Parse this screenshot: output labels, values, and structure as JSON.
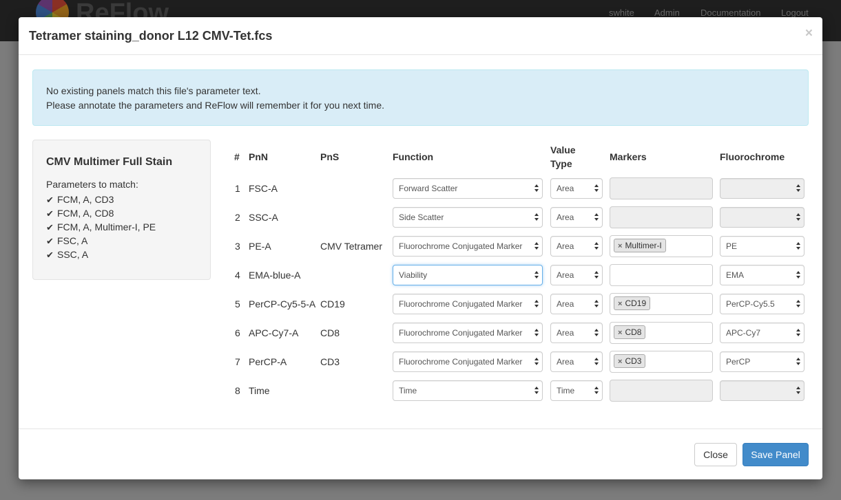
{
  "navbar": {
    "brand": "ReFlow",
    "links": [
      "swhite",
      "Admin",
      "Documentation",
      "Logout"
    ]
  },
  "modal": {
    "title": "Tetramer staining_donor L12 CMV-Tet.fcs",
    "close_symbol": "×"
  },
  "alert": {
    "line1": "No existing panels match this file's parameter text.",
    "line2": "Please annotate the parameters and ReFlow will remember it for you next time."
  },
  "panel": {
    "name": "CMV Multimer Full Stain",
    "params_label": "Parameters to match:",
    "params": [
      "FCM, A, CD3",
      "FCM, A, CD8",
      "FCM, A, Multimer-I, PE",
      "FSC, A",
      "SSC, A"
    ]
  },
  "table": {
    "headers": {
      "num": "#",
      "pnn": "PnN",
      "pns": "PnS",
      "function": "Function",
      "value_type_1": "Value",
      "value_type_2": "Type",
      "markers": "Markers",
      "fluorochrome": "Fluorochrome"
    },
    "rows": [
      {
        "num": "1",
        "pnn": "FSC-A",
        "pns": "",
        "function": "Forward Scatter",
        "value_type": "Area",
        "marker": "",
        "fluorochrome": ""
      },
      {
        "num": "2",
        "pnn": "SSC-A",
        "pns": "",
        "function": "Side Scatter",
        "value_type": "Area",
        "marker": "",
        "fluorochrome": ""
      },
      {
        "num": "3",
        "pnn": "PE-A",
        "pns": "CMV Tetramer",
        "function": "Fluorochrome Conjugated Marker",
        "value_type": "Area",
        "marker": "Multimer-I",
        "fluorochrome": "PE"
      },
      {
        "num": "4",
        "pnn": "EMA-blue-A",
        "pns": "",
        "function": "Viability",
        "value_type": "Area",
        "marker": "",
        "fluorochrome": "EMA"
      },
      {
        "num": "5",
        "pnn": "PerCP-Cy5-5-A",
        "pns": "CD19",
        "function": "Fluorochrome Conjugated Marker",
        "value_type": "Area",
        "marker": "CD19",
        "fluorochrome": "PerCP-Cy5.5"
      },
      {
        "num": "6",
        "pnn": "APC-Cy7-A",
        "pns": "CD8",
        "function": "Fluorochrome Conjugated Marker",
        "value_type": "Area",
        "marker": "CD8",
        "fluorochrome": "APC-Cy7"
      },
      {
        "num": "7",
        "pnn": "PerCP-A",
        "pns": "CD3",
        "function": "Fluorochrome Conjugated Marker",
        "value_type": "Area",
        "marker": "CD3",
        "fluorochrome": "PerCP"
      },
      {
        "num": "8",
        "pnn": "Time",
        "pns": "",
        "function": "Time",
        "value_type": "Time",
        "marker": "",
        "fluorochrome": ""
      }
    ]
  },
  "footer": {
    "close_label": "Close",
    "save_label": "Save Panel"
  },
  "colors": {
    "alert_bg": "#d9edf7",
    "primary": "#428bca"
  }
}
